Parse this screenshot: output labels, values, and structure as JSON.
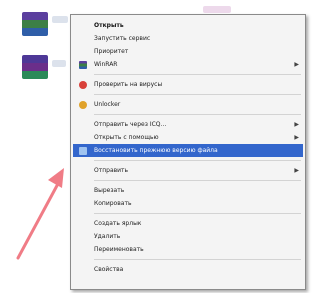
{
  "context_menu": {
    "items": [
      {
        "label": "Открыть",
        "bold": true
      },
      {
        "label": "Запустить сервис"
      },
      {
        "label": "Приоритет"
      },
      {
        "label": "WinRAR",
        "has_submenu": true,
        "icon": "winrar-icon"
      },
      {
        "label": "Проверить на вирусы",
        "icon": "antivirus-icon"
      },
      {
        "label": "Unlocker",
        "icon": "unlocker-icon"
      },
      {
        "label": "Отправить через ICQ...",
        "has_submenu": true
      },
      {
        "label": "Открыть с помощью",
        "has_submenu": true
      },
      {
        "label": "Восстановить прежнюю версию файла",
        "highlight": true,
        "icon": "restore-icon"
      },
      {
        "label": "Отправить",
        "has_submenu": true
      },
      {
        "label": "Вырезать"
      },
      {
        "label": "Копировать"
      },
      {
        "label": "Создать ярлык"
      },
      {
        "label": "Удалить"
      },
      {
        "label": "Переименовать"
      },
      {
        "label": "Свойства"
      }
    ]
  },
  "colors": {
    "highlight": "#3366cc",
    "menu_bg": "#f4f4f4",
    "arrow": "#f07c86"
  },
  "icons": {
    "archive_file": "winrar-archive-icon",
    "pointer": "red-arrow-annotation"
  }
}
